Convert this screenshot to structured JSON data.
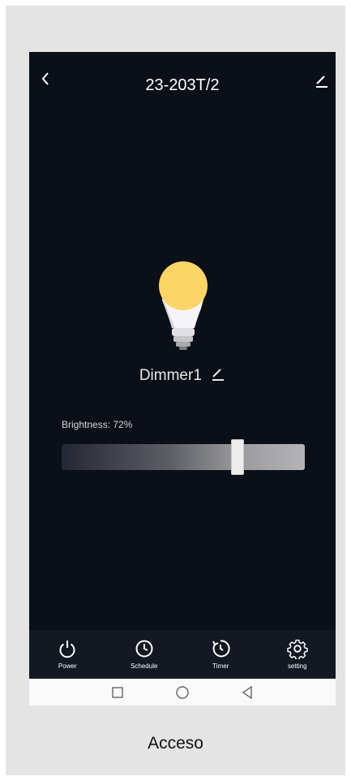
{
  "header": {
    "title": "23-203T/2",
    "back_icon": "chevron-left-icon",
    "edit_icon": "pencil-icon"
  },
  "device": {
    "name": "Dimmer1",
    "edit_icon": "pencil-icon",
    "bulb_icon": "light-bulb-icon",
    "bulb_color": "#fcd467"
  },
  "brightness": {
    "label": "Brightness: 72%",
    "value": 0.72
  },
  "bottom_nav": [
    {
      "label": "Power",
      "icon": "power-icon"
    },
    {
      "label": "Schedule",
      "icon": "clock-icon"
    },
    {
      "label": "Timer",
      "icon": "timer-icon"
    },
    {
      "label": "setting",
      "icon": "gear-icon"
    }
  ],
  "system_bar": [
    "square-icon",
    "circle-icon",
    "triangle-back-icon"
  ],
  "caption": "Acceso",
  "colors": {
    "background": "#0b0f17",
    "nav_background": "#121922",
    "frame": "#e4e4e4",
    "text": "#ffffff"
  }
}
